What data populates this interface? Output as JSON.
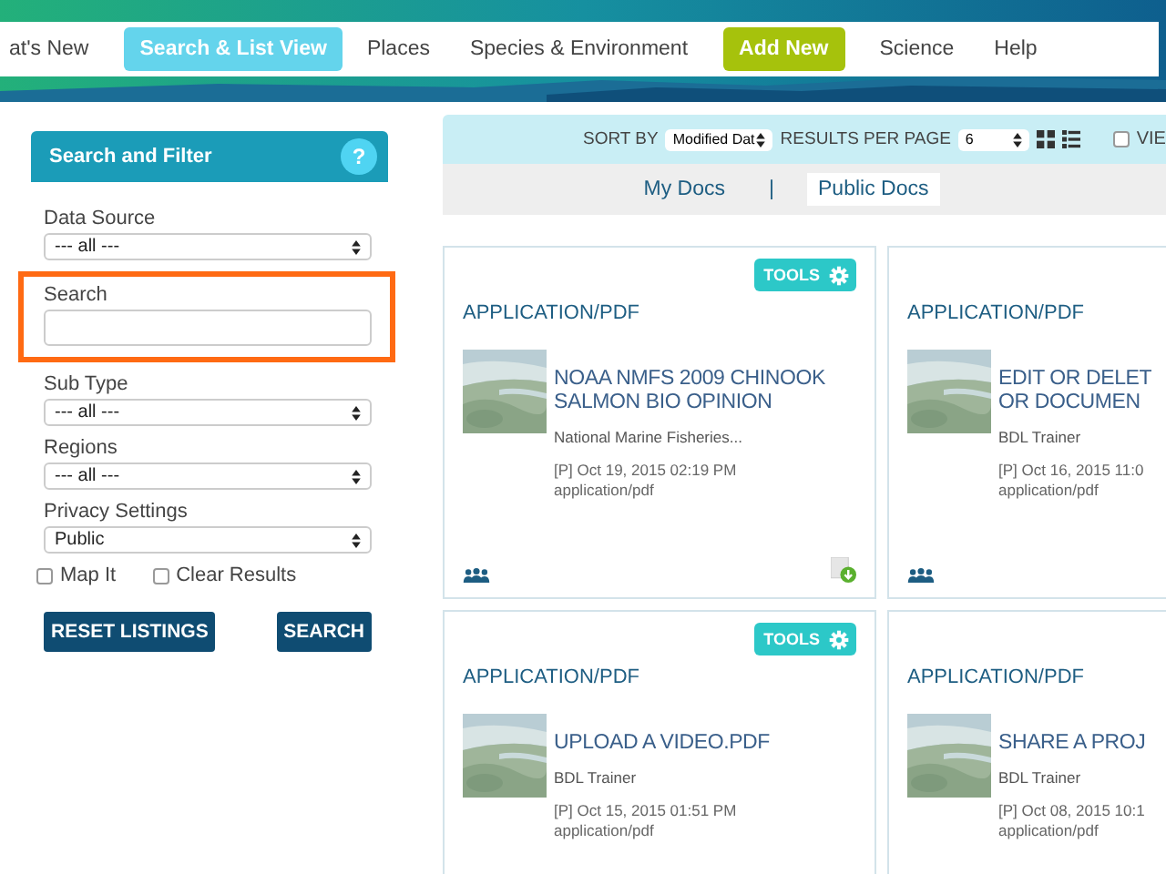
{
  "nav": {
    "items": [
      {
        "label": "at's New",
        "kind": "link",
        "selected": false
      },
      {
        "label": "Search & List View",
        "kind": "link",
        "selected": true
      },
      {
        "label": "Places",
        "kind": "link",
        "selected": false
      },
      {
        "label": "Species & Environment",
        "kind": "link",
        "selected": false
      },
      {
        "label": "Add New",
        "kind": "button",
        "selected": false
      },
      {
        "label": "Science",
        "kind": "link",
        "selected": false
      },
      {
        "label": "Help",
        "kind": "link",
        "selected": false
      }
    ]
  },
  "sidebar": {
    "title": "Search and Filter",
    "help": "?",
    "fields": [
      {
        "kind": "select",
        "label": "Data Source",
        "value": "--- all ---",
        "highlighted": false
      },
      {
        "kind": "text",
        "label": "Search",
        "highlighted": true
      },
      {
        "kind": "select",
        "label": "Sub Type",
        "value": "--- all ---",
        "highlighted": false
      },
      {
        "kind": "select",
        "label": "Regions",
        "value": "--- all ---",
        "highlighted": false
      },
      {
        "kind": "select",
        "label": "Privacy Settings",
        "value": "Public",
        "highlighted": false
      }
    ],
    "checkboxes": [
      {
        "label": "Map It",
        "checked": false
      },
      {
        "label": "Clear Results",
        "checked": false
      }
    ],
    "buttons": [
      "RESET LISTINGS",
      "SEARCH"
    ]
  },
  "toolbar": {
    "sort_label": "SORT BY",
    "sort_value": "Modified Dat",
    "per_page_label": "RESULTS PER PAGE",
    "per_page_value": "6",
    "view_checkbox": {
      "label": "VIE",
      "checked": false
    }
  },
  "doc_tabs": {
    "separator": "|",
    "items": [
      {
        "label": "My Docs",
        "selected": false
      },
      {
        "label": "Public Docs",
        "selected": true
      }
    ]
  },
  "cards": [
    {
      "tools": "TOOLS",
      "type": "APPLICATION/PDF",
      "title_lines": [
        "NOAA NMFS 2009 CHINOOK",
        "SALMON BIO OPINION"
      ],
      "author": "National Marine Fisheries...",
      "date": "[P] Oct 19, 2015 02:19 PM",
      "mime": "application/pdf",
      "shared": true,
      "download": true
    },
    {
      "type": "APPLICATION/PDF",
      "title_lines": [
        "EDIT OR DELET",
        "OR DOCUMEN"
      ],
      "author": "BDL Trainer",
      "date": "[P] Oct 16, 2015 11:0",
      "mime": "application/pdf",
      "shared": true,
      "download": false
    },
    {
      "tools": "TOOLS",
      "type": "APPLICATION/PDF",
      "title_lines": [
        "UPLOAD A VIDEO.PDF"
      ],
      "author": "BDL Trainer",
      "date": "[P] Oct 15, 2015 01:51 PM",
      "mime": "application/pdf"
    },
    {
      "type": "APPLICATION/PDF",
      "title_lines": [
        "SHARE A PROJ"
      ],
      "author": "BDL Trainer",
      "date": "[P] Oct 08, 2015 10:1",
      "mime": "application/pdf"
    }
  ]
}
